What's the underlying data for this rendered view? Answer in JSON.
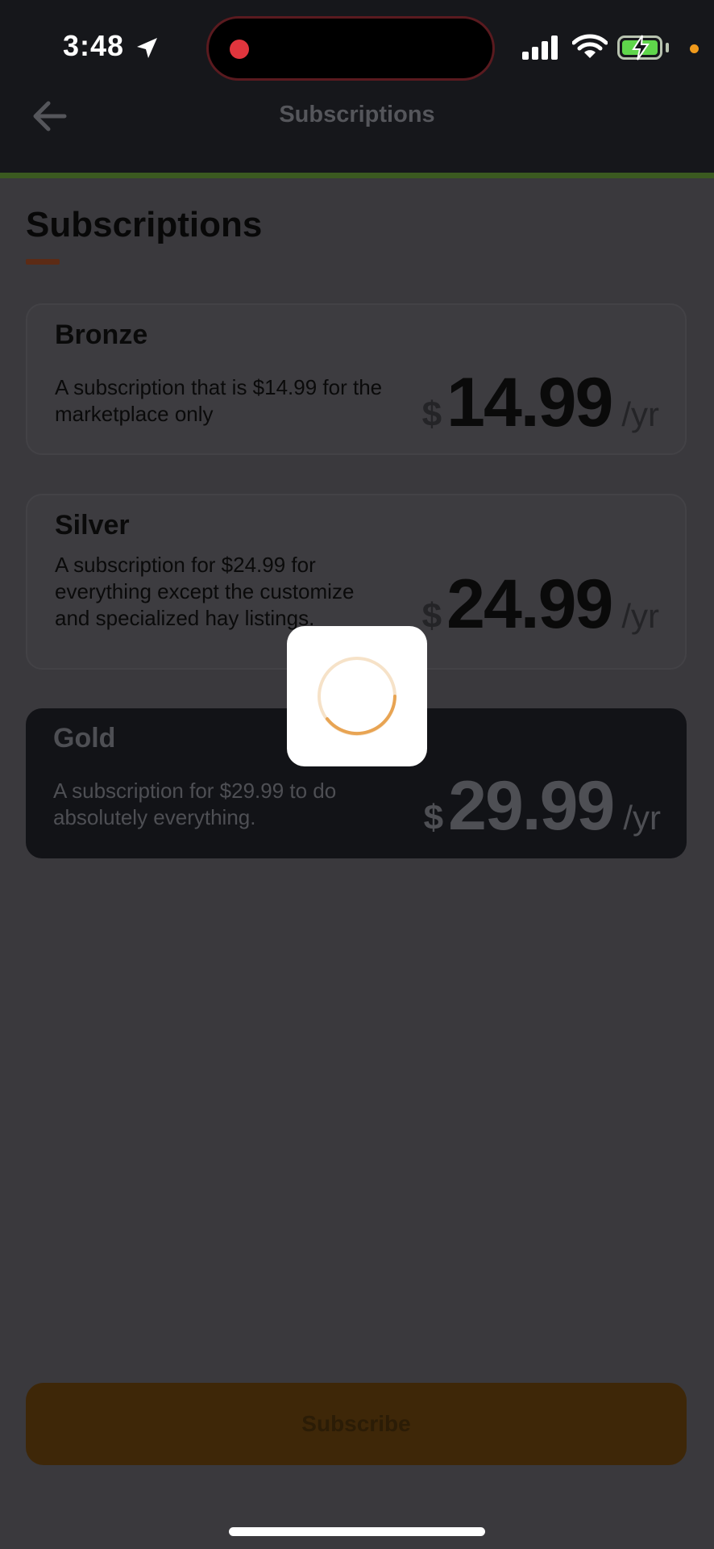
{
  "status_bar": {
    "time": "3:48",
    "icons": [
      "location-arrow-icon",
      "recording-dot-icon",
      "cellular-signal-icon",
      "wifi-icon",
      "battery-charging-icon",
      "privacy-dot-icon"
    ]
  },
  "nav": {
    "back_icon": "arrow-left-icon",
    "title": "Subscriptions"
  },
  "page": {
    "title": "Subscriptions"
  },
  "plans": [
    {
      "name": "Bronze",
      "description": "A subscription that is $14.99 for the marketplace only",
      "currency": "$",
      "amount": "14.99",
      "period": "/yr",
      "selected": false
    },
    {
      "name": "Silver",
      "description": "A subscription for $24.99 for everything except the customize and specialized hay listings.",
      "currency": "$",
      "amount": "24.99",
      "period": "/yr",
      "selected": false
    },
    {
      "name": "Gold",
      "description": "A subscription for $29.99 to do absolutely everything.",
      "currency": "$",
      "amount": "29.99",
      "period": "/yr",
      "selected": true
    }
  ],
  "loading": {
    "icon": "loading-spinner-icon",
    "visible": true
  },
  "actions": {
    "subscribe_label": "Subscribe"
  },
  "colors": {
    "accent_orange": "#e8a453",
    "subscribe_bg": "#3e2708",
    "selected_card_bg": "#121317",
    "overlay_bg": "#3a393d"
  }
}
